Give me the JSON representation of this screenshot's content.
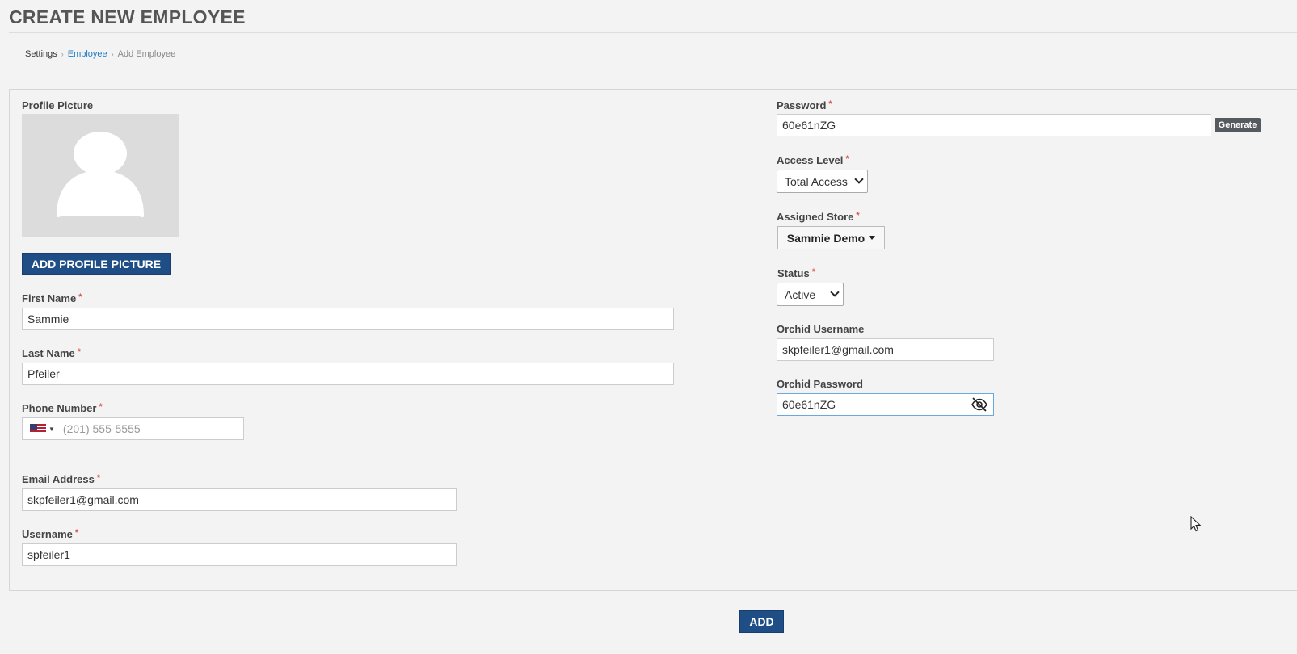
{
  "page": {
    "title": "CREATE NEW EMPLOYEE"
  },
  "breadcrumb": {
    "items": [
      "Settings",
      "Employee",
      "Add Employee"
    ]
  },
  "profile": {
    "label": "Profile Picture",
    "add_button": "ADD PROFILE PICTURE"
  },
  "fields": {
    "first_name": {
      "label": "First Name",
      "value": "Sammie"
    },
    "last_name": {
      "label": "Last Name",
      "value": "Pfeiler"
    },
    "phone": {
      "label": "Phone Number",
      "placeholder": "(201) 555-5555",
      "country_icon": "us-flag-icon"
    },
    "email": {
      "label": "Email Address",
      "value": "skpfeiler1@gmail.com"
    },
    "username": {
      "label": "Username",
      "value": "spfeiler1"
    },
    "password": {
      "label": "Password",
      "value": "60e61nZG",
      "generate_label": "Generate"
    },
    "access_level": {
      "label": "Access Level",
      "selected": "Total Access"
    },
    "assigned_store": {
      "label": "Assigned Store",
      "selected": "Sammie Demo"
    },
    "status": {
      "label": "Status",
      "selected": "Active"
    },
    "orchid_username": {
      "label": "Orchid Username",
      "value": "skpfeiler1@gmail.com"
    },
    "orchid_password": {
      "label": "Orchid Password",
      "value": "60e61nZG",
      "toggle_icon": "eye-slash-icon"
    }
  },
  "required_marker": "*",
  "actions": {
    "add_label": "ADD"
  },
  "colors": {
    "primary": "#1f4e87",
    "link": "#1e7bc4",
    "required": "#d9534f"
  }
}
